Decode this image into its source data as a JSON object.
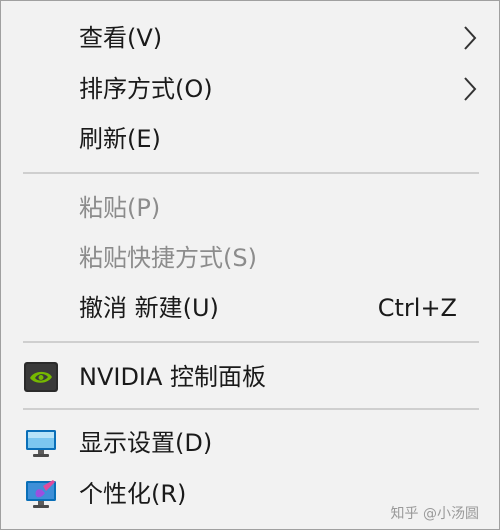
{
  "menu": {
    "items": [
      {
        "label": "查看(V)"
      },
      {
        "label": "排序方式(O)"
      },
      {
        "label": "刷新(E)"
      },
      {
        "label": "粘贴(P)"
      },
      {
        "label": "粘贴快捷方式(S)"
      },
      {
        "label": "撤消 新建(U)",
        "shortcut": "Ctrl+Z"
      },
      {
        "label": "NVIDIA 控制面板",
        "icon": "nvidia-icon"
      },
      {
        "label": "显示设置(D)",
        "icon": "display-settings-icon"
      },
      {
        "label": "个性化(R)",
        "icon": "personalization-icon"
      }
    ]
  },
  "watermark": "知乎 @小汤圆",
  "colors": {
    "background": "#f2f2f2",
    "text": "#1a1a1a",
    "disabled_text": "#8c8c8c",
    "separator": "#cfcfcf",
    "nvidia_green": "#76b900"
  }
}
